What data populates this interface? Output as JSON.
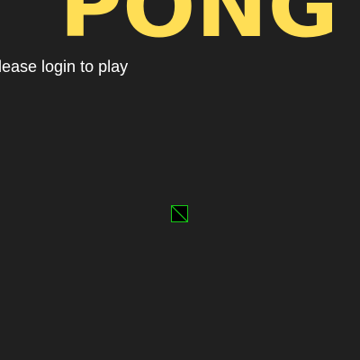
{
  "game": {
    "title": "PONG",
    "message": "Please login to play",
    "login_icon": "broken-image-icon"
  },
  "colors": {
    "background": "#202020",
    "title": "#ffde55",
    "message": "#ffffff",
    "icon_border": "#17c817",
    "icon_fill": "#000000"
  }
}
